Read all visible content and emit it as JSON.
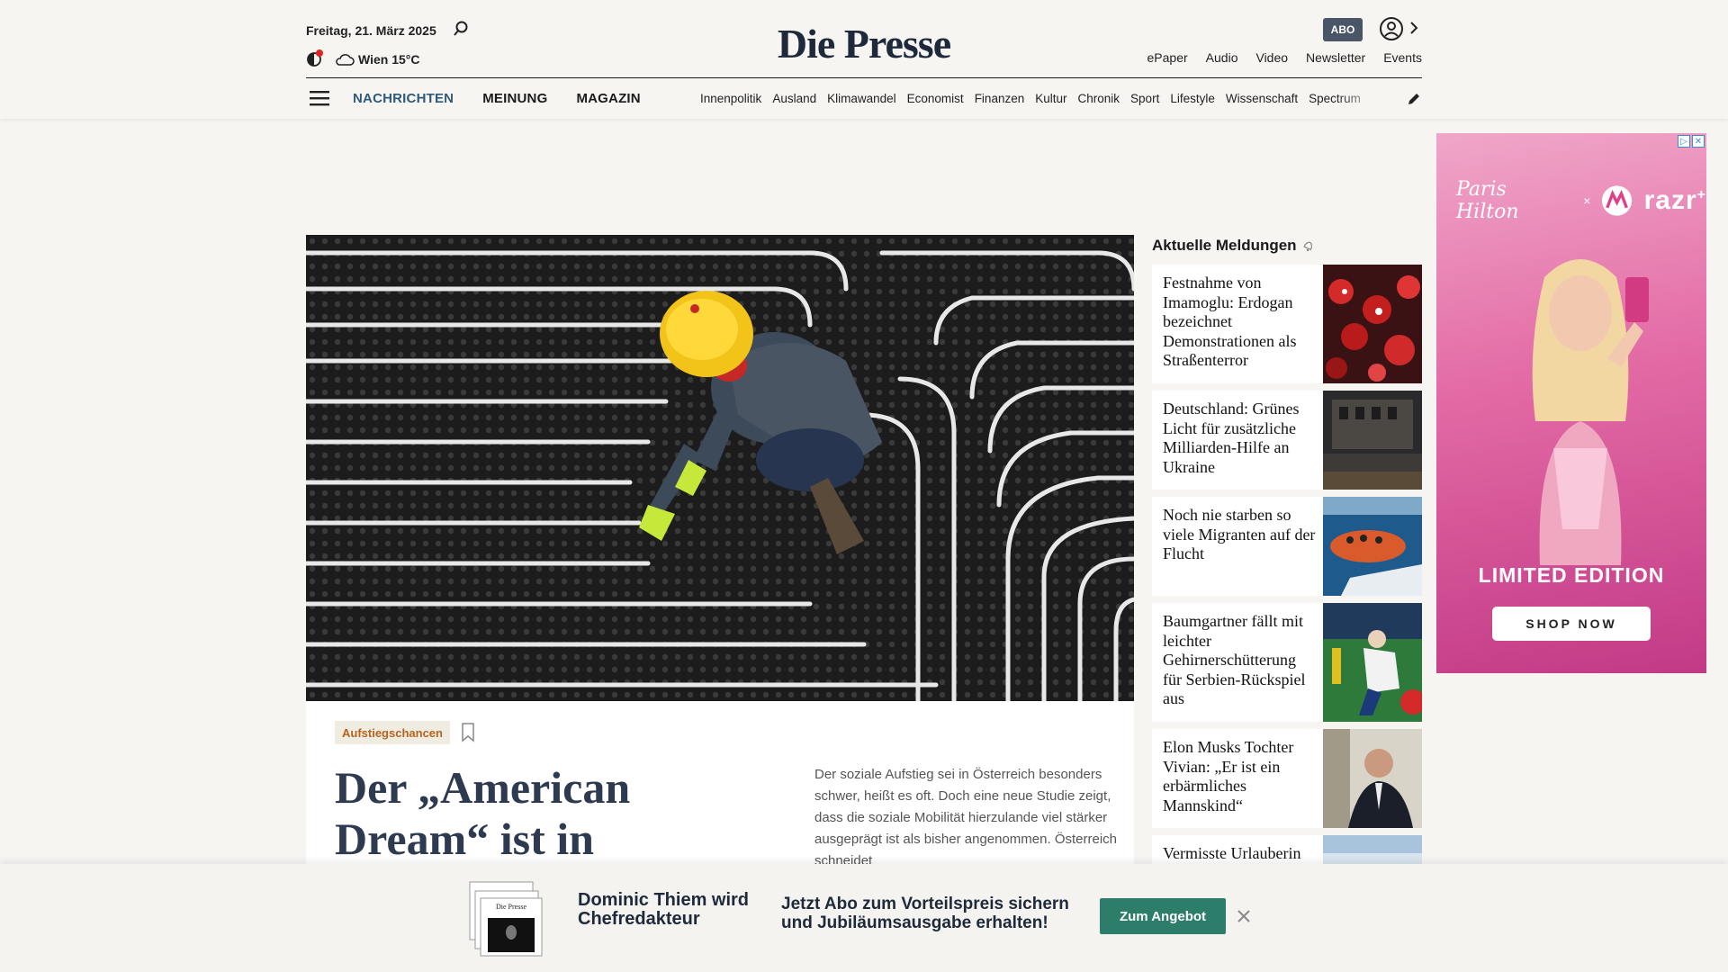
{
  "header": {
    "date": "Freitag, 21. März 2025",
    "weather": "Wien 15°C",
    "logo": "Die Presse",
    "abo": "ABO",
    "top_links": [
      "ePaper",
      "Audio",
      "Video",
      "Newsletter",
      "Events"
    ],
    "main_nav": [
      "NACHRICHTEN",
      "MEINUNG",
      "MAGAZIN"
    ],
    "sub_nav": [
      "Innenpolitik",
      "Ausland",
      "Klimawandel",
      "Economist",
      "Finanzen",
      "Kultur",
      "Chronik",
      "Sport",
      "Lifestyle",
      "Wissenschaft",
      "Spectrum"
    ]
  },
  "hero": {
    "tag": "Aufstiegschancen",
    "headline": "Der „American Dream“ ist in",
    "lead": "Der soziale Aufstieg sei in Österreich besonders schwer, heißt es oft. Doch eine neue Studie zeigt, dass die soziale Mobilität hierzulande viel stärker ausgeprägt ist als bisher angenommen. Österreich schneidet"
  },
  "news": {
    "title": "Aktuelle Meldungen",
    "items": [
      "Festnahme von Imamoglu: Erdogan bezeichnet Demonstrationen als Straßenterror",
      "Deutschland: Grünes Licht für zusätzliche Milliarden-Hilfe an Ukraine",
      "Noch nie starben so viele Migranten auf der Flucht",
      "Baumgartner fällt mit leichter Gehirnerschütterung für Serbien-Rückspiel aus",
      "Elon Musks Tochter Vivian: „Er ist ein erbärmliches Mannskind“",
      "Vermisste Urlauberin"
    ]
  },
  "ad": {
    "signature": "Paris Hilton",
    "x": "×",
    "brand": "razr",
    "brand_sup": "+",
    "headline": "LIMITED EDITION",
    "cta": "SHOP NOW"
  },
  "promo": {
    "headline": "Dominic Thiem wird Chefredakteur",
    "text": "Jetzt Abo zum Vorteilspreis sichern und Jubiläumsausgabe erhalten!",
    "button": "Zum Angebot"
  },
  "colors": {
    "nav_active": "#2f5a7a",
    "tag_text": "#b5641e",
    "promo_button": "#2c7d6a",
    "abo_badge": "#4a5568"
  }
}
